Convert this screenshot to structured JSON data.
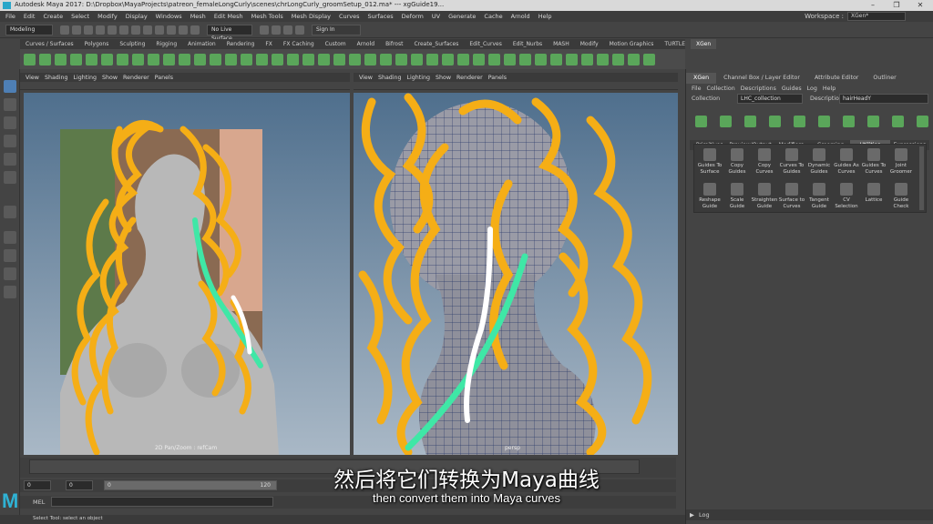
{
  "window": {
    "title": "Autodesk Maya 2017: D:\\Dropbox\\MayaProjects\\patreon_femaleLongCurly\\scenes\\chrLongCurly_groomSetup_012.ma*   ---   xgGuide19..."
  },
  "menubar": {
    "items": [
      "File",
      "Edit",
      "Create",
      "Select",
      "Modify",
      "Display",
      "Windows",
      "Mesh",
      "Edit Mesh",
      "Mesh Tools",
      "Mesh Display",
      "Curves",
      "Surfaces",
      "Deform",
      "UV",
      "Generate",
      "Cache",
      "Arnold",
      "Help"
    ],
    "workspace_label": "Workspace :",
    "workspace_value": "XGen*"
  },
  "statusline": {
    "mode": "Modeling",
    "live_surface": "No Live Surface",
    "sign_in": "Sign In"
  },
  "shelf": {
    "tabs": [
      "Curves / Surfaces",
      "Polygons",
      "Sculpting",
      "Rigging",
      "Animation",
      "Rendering",
      "FX",
      "FX Caching",
      "Custom",
      "Arnold",
      "Bifrost",
      "Create_Surfaces",
      "Edit_Curves",
      "Edit_Nurbs",
      "MASH",
      "Modify",
      "Motion Graphics",
      "TURTLE",
      "XGen"
    ],
    "active_tab": "XGen"
  },
  "viewport_left": {
    "menus": [
      "View",
      "Shading",
      "Lighting",
      "Show",
      "Renderer",
      "Panels"
    ],
    "camera_label": "2D Pan/Zoom : refCam"
  },
  "viewport_right": {
    "menus": [
      "View",
      "Shading",
      "Lighting",
      "Show",
      "Renderer",
      "Panels"
    ],
    "camera_label": "persp"
  },
  "timeline": {
    "start": "0",
    "start2": "0",
    "range_start": "0",
    "range_end": "120",
    "mel_label": "MEL",
    "help_text": "Select Tool: select an object"
  },
  "xgen_panel": {
    "tabs": [
      "XGen",
      "Channel Box / Layer Editor",
      "Attribute Editor",
      "Outliner"
    ],
    "active_tab": "XGen",
    "menus": [
      "File",
      "Collection",
      "Descriptions",
      "Guides",
      "Log",
      "Help"
    ],
    "collection_label": "Collection",
    "collection_value": "LHC_collection",
    "description_label": "Description",
    "description_value": "hairHeadY",
    "subtabs": [
      "Primitives",
      "Preview/Output",
      "Modifiers",
      "Grooming",
      "Utilities",
      "Expressions"
    ],
    "active_subtab": "Utilities",
    "utilities": [
      [
        "Guides To",
        "Surface"
      ],
      [
        "Copy",
        "Guides"
      ],
      [
        "Copy",
        "Curves"
      ],
      [
        "Curves To",
        "Guides"
      ],
      [
        "Dynamic",
        "Guides"
      ],
      [
        "Guides As",
        "Curves"
      ],
      [
        "Guides To",
        "Curves"
      ],
      [
        "Joint",
        "Groomer"
      ],
      [
        "Reshape",
        "Guide"
      ],
      [
        "Scale",
        "Guide"
      ],
      [
        "Straighten",
        "Guide"
      ],
      [
        "Surface to",
        "Curves"
      ],
      [
        "Tangent",
        "Guide"
      ],
      [
        "CV",
        "Selection"
      ],
      [
        "Lattice",
        ""
      ],
      [
        "Guide",
        "Check"
      ]
    ],
    "log_label": "Log"
  },
  "subtitles": {
    "chinese": "然后将它们转换为Maya曲线",
    "english": "then convert them into Maya curves"
  },
  "colors": {
    "accent": "#2fb2d4",
    "hair_curves": "#f5ae16",
    "guide_green": "#3fe7a6",
    "guide_white": "#ffffff"
  },
  "logo_text": "M"
}
